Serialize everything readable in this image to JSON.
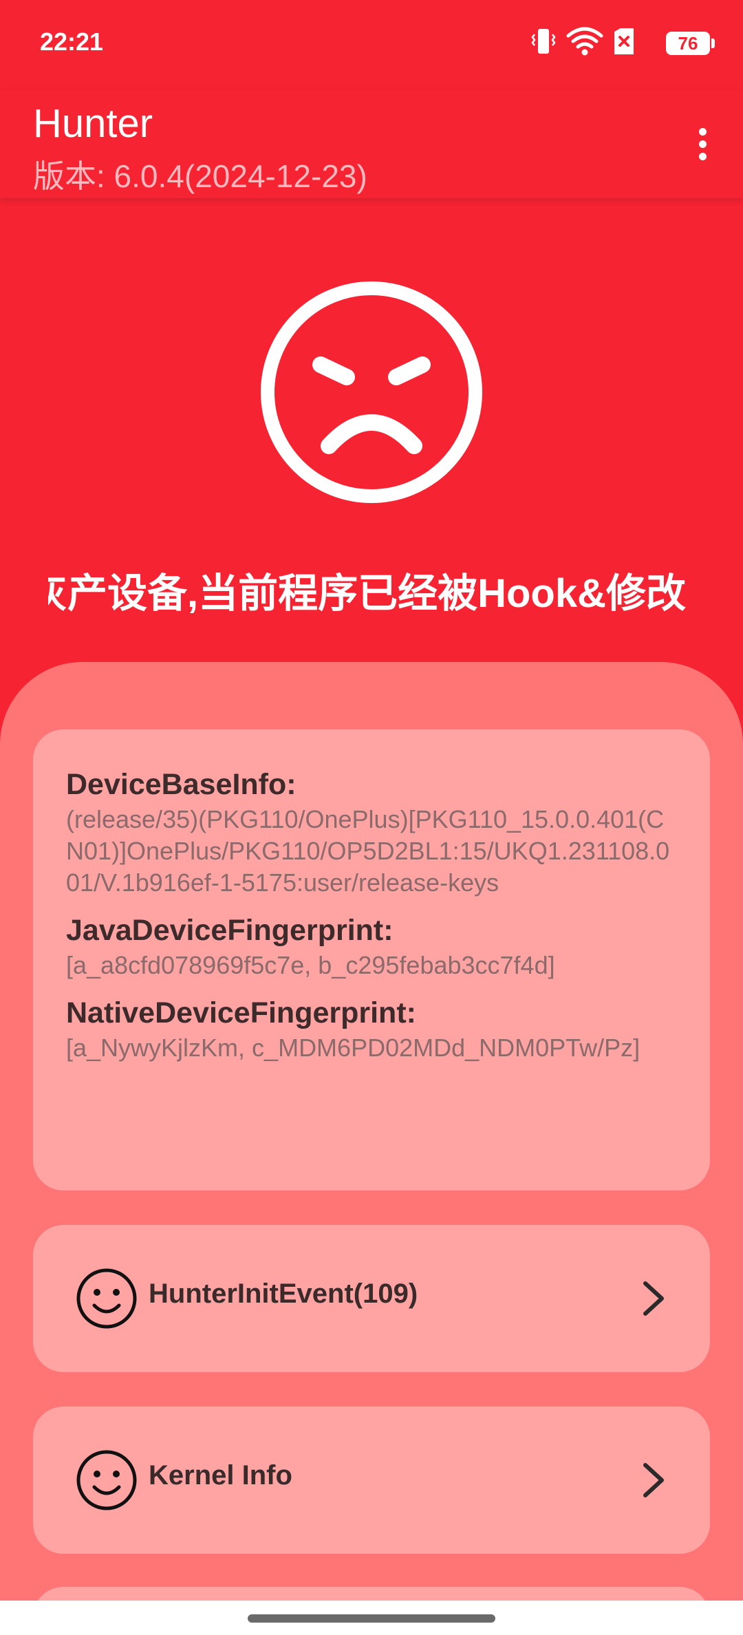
{
  "status_bar": {
    "time": "22:21",
    "battery": "76",
    "icons": [
      "vibrate-icon",
      "wifi-icon",
      "sim-off-icon",
      "battery-icon"
    ]
  },
  "app_bar": {
    "title": "Hunter",
    "subtitle": "版本: 6.0.4(2024-12-23)",
    "menu_icon": "more-vert-icon"
  },
  "status_face": "angry-face-icon",
  "warning": "灰产设备,当前程序已经被Hook&修改",
  "device_info": {
    "base_key": "DeviceBaseInfo:",
    "base_value": "(release/35)(PKG110/OnePlus)[PKG110_15.0.0.401(CN01)]OnePlus/PKG110/OP5D2BL1:15/UKQ1.231108.001/V.1b916ef-1-5175:user/release-keys",
    "java_key": "JavaDeviceFingerprint:",
    "java_value": "[a_a8cfd078969f5c7e, b_c295febab3cc7f4d]",
    "native_key": "NativeDeviceFingerprint:",
    "native_value": "[a_NywyKjlzKm, c_MDM6PD02MDd_NDM0PTw/Pz]"
  },
  "menu_items": [
    {
      "label": "HunterInitEvent(109)",
      "icon": "smiley-icon"
    },
    {
      "label": "Kernel Info",
      "icon": "smiley-icon"
    }
  ],
  "colors": {
    "primary": "#f62332",
    "sheet": "#ff7474",
    "card": "#ffa3a3"
  }
}
